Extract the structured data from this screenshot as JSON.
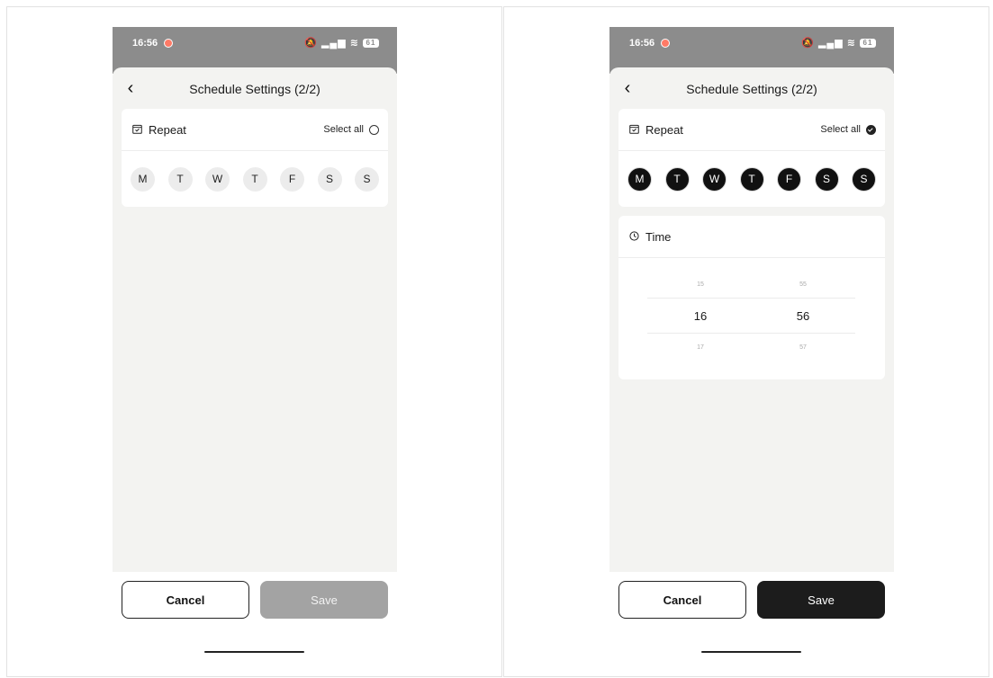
{
  "screens": [
    {
      "status": {
        "time": "16:56",
        "battery": "61"
      },
      "title": "Schedule Settings (2/2)",
      "repeat": {
        "label": "Repeat",
        "select_all": "Select all",
        "select_all_checked": false,
        "days": [
          {
            "label": "M",
            "selected": false
          },
          {
            "label": "T",
            "selected": false
          },
          {
            "label": "W",
            "selected": false
          },
          {
            "label": "T",
            "selected": false
          },
          {
            "label": "F",
            "selected": false
          },
          {
            "label": "S",
            "selected": false
          },
          {
            "label": "S",
            "selected": false
          }
        ]
      },
      "buttons": {
        "cancel": "Cancel",
        "save": "Save",
        "save_enabled": false
      }
    },
    {
      "status": {
        "time": "16:56",
        "battery": "61"
      },
      "title": "Schedule Settings (2/2)",
      "repeat": {
        "label": "Repeat",
        "select_all": "Select all",
        "select_all_checked": true,
        "days": [
          {
            "label": "M",
            "selected": true
          },
          {
            "label": "T",
            "selected": true
          },
          {
            "label": "W",
            "selected": true
          },
          {
            "label": "T",
            "selected": true
          },
          {
            "label": "F",
            "selected": true
          },
          {
            "label": "S",
            "selected": true
          },
          {
            "label": "S",
            "selected": true
          }
        ]
      },
      "time": {
        "label": "Time",
        "hours": [
          "15",
          "16",
          "17"
        ],
        "minutes": [
          "55",
          "56",
          "57"
        ]
      },
      "buttons": {
        "cancel": "Cancel",
        "save": "Save",
        "save_enabled": true
      }
    }
  ],
  "colors": {
    "accent": "#1c1c1c",
    "disabled": "#a3a3a3",
    "sheet_bg": "#f3f3f1",
    "status_bg": "#8c8c8c"
  }
}
